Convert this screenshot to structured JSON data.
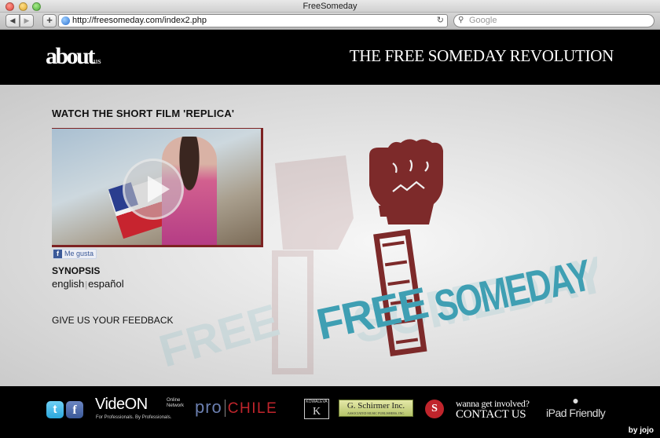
{
  "browser": {
    "window_title": "FreeSomeday",
    "url": "http://freesomeday.com/index2.php",
    "search_placeholder": "Google"
  },
  "header": {
    "logo_about": "about",
    "logo_us": "us",
    "title": "THE FREE SOMEDAY REVOLUTION"
  },
  "main": {
    "film_heading": "WATCH THE SHORT FILM 'REPLICA'",
    "like_label": "Me gusta",
    "synopsis_title": "SYNOPSIS",
    "lang_english": "english",
    "lang_separator": "|",
    "lang_spanish": "español",
    "feedback": "GIVE US YOUR FEEDBACK"
  },
  "logo_art": {
    "word_free": "FREE",
    "word_someday": "SOMEDAY",
    "colors": {
      "teal": "#3f9fb3",
      "maroon": "#7d2a2a"
    }
  },
  "footer": {
    "videon_main": "VideON",
    "videon_side": "Online Network",
    "videon_tag": "For Professionals. By Professionals.",
    "prochile_pro": "pro",
    "prochile_chile": "CHILE",
    "kowalevsky": "KOWALEVA",
    "schirmer": "G. Schirmer Inc.",
    "schirmer_sub": "ASSOCIATED MUSIC PUBLISHERS, INC.",
    "involve_top": "wanna get involved?",
    "involve_bottom": "CONTACT US",
    "ipad_text": "iPad Friendly",
    "credit": "by jojo"
  }
}
